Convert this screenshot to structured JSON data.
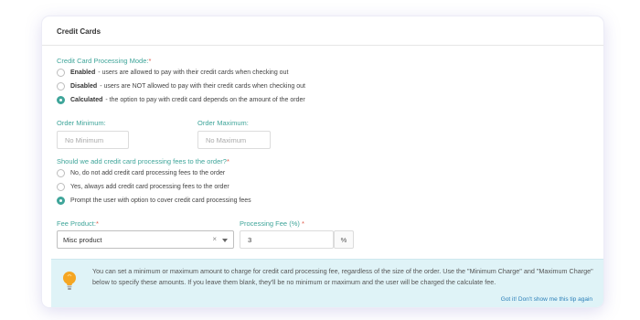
{
  "card": {
    "title": "Credit Cards"
  },
  "mode": {
    "label": "Credit Card Processing Mode:",
    "required": "*",
    "options": [
      {
        "name": "Enabled",
        "desc": " - users are allowed to pay with their credit cards when checking out",
        "checked": false
      },
      {
        "name": "Disabled",
        "desc": " - users are NOT allowed to pay with their credit cards when checking out",
        "checked": false
      },
      {
        "name": "Calculated",
        "desc": " - the option to pay with credit card depends on the amount of the order",
        "checked": true
      }
    ]
  },
  "order_min": {
    "label": "Order Minimum:",
    "placeholder": "No Minimum"
  },
  "order_max": {
    "label": "Order Maximum:",
    "placeholder": "No Maximum"
  },
  "fees": {
    "label": "Should we add credit card processing fees to the order?",
    "required": "*",
    "options": [
      {
        "text": "No, do not add credit card processing fees to the order",
        "checked": false
      },
      {
        "text": "Yes, always add credit card processing fees to the order",
        "checked": false
      },
      {
        "text": "Prompt the user with option to cover credit card processing fees",
        "checked": true
      }
    ]
  },
  "fee_product": {
    "label": "Fee Product:",
    "required": "*",
    "value": "Misc product",
    "clear": "×"
  },
  "processing_fee": {
    "label": "Processing Fee (%) ",
    "required": "*",
    "value": "3",
    "unit": "%"
  },
  "tip": {
    "text": "You can set a minimum or maximum amount to charge for credit card processing fee, regardless of the size of the order. Use the \"Minimum Charge\" and \"Maximum Charge\" below to specify these amounts. If you leave them blank, they'll be no minimum or maximum and the user will be charged the calculate fee.",
    "dismiss": "Got it! Don't show me this tip again"
  },
  "colors": {
    "accent": "#3fa59a",
    "required": "#e05a4a",
    "tip_bg": "#dff3f7",
    "link": "#2a7fb8",
    "bulb": "#f5a623"
  }
}
